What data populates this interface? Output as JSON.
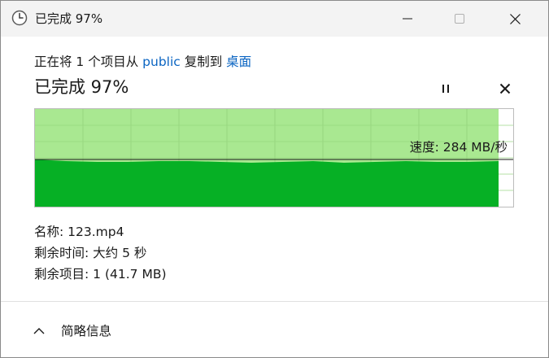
{
  "window": {
    "title": "已完成 97%",
    "icon": "clock-icon"
  },
  "header": {
    "prefix": "正在将 1 个项目从 ",
    "source": "public",
    "middle": " 复制到 ",
    "destination": "桌面"
  },
  "progress": {
    "heading": "已完成 97%",
    "percent": 97,
    "speed_label": "速度: 284 MB/秒"
  },
  "details": {
    "name_label": "名称:",
    "name_value": "123.mp4",
    "time_label": "剩余时间:",
    "time_value": "大约 5 秒",
    "items_label": "剩余项目:",
    "items_value": "1 (41.7 MB)"
  },
  "footer": {
    "toggle_label": "简略信息",
    "toggle_icon": "chevron-up-icon"
  },
  "colors": {
    "link": "#0a64c2",
    "graph_fill": "#06b025",
    "graph_done": "#a9e891",
    "graph_grid": "#97d67f",
    "titlebar": "#f3f3f3"
  }
}
